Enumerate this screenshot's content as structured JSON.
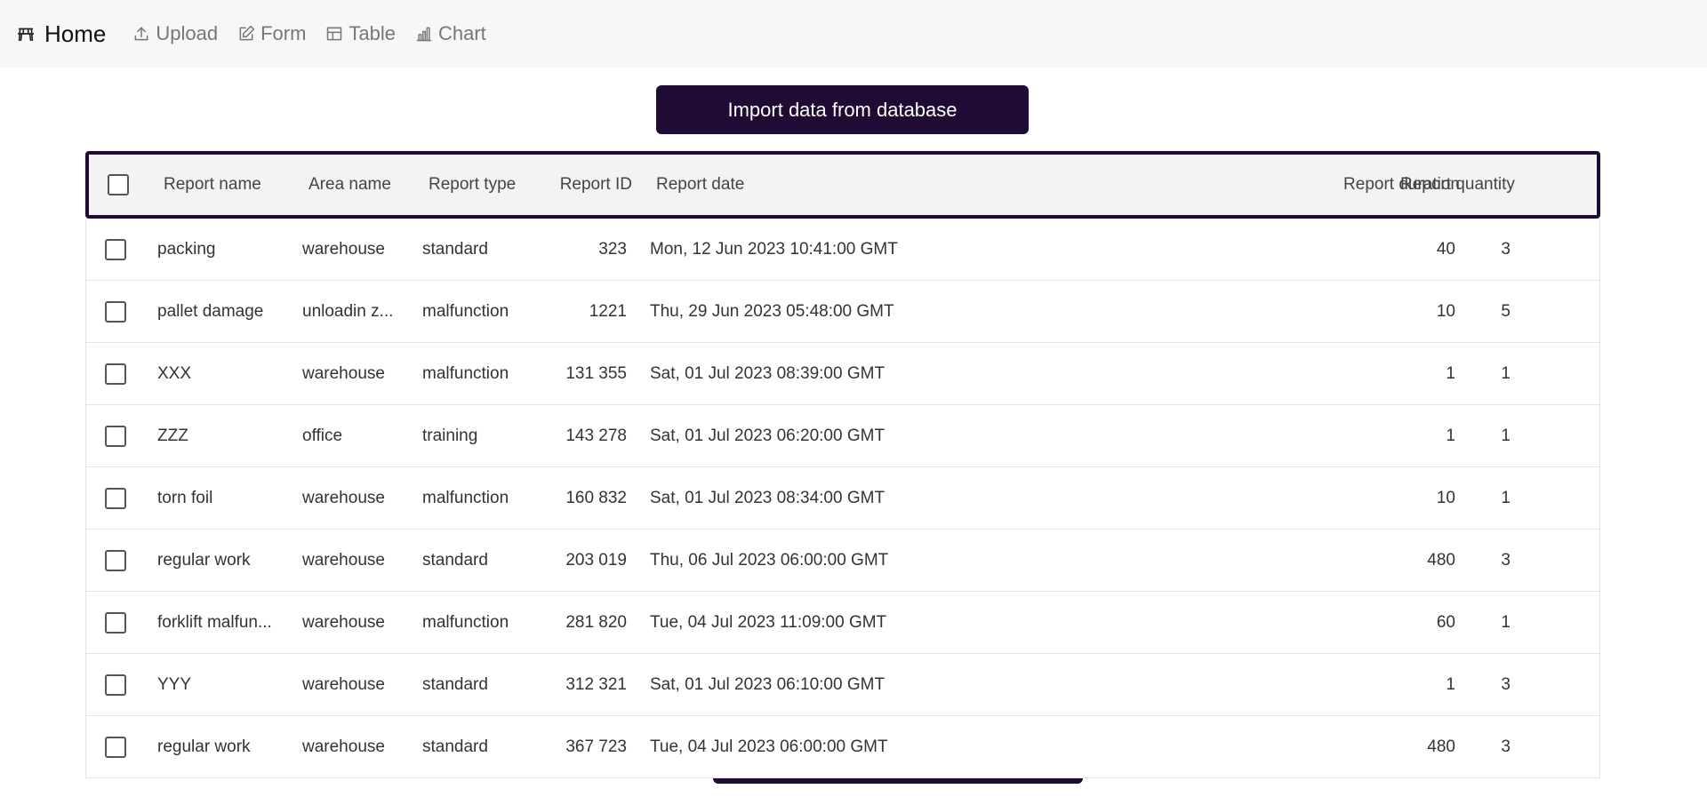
{
  "nav": {
    "home": "Home",
    "upload": "Upload",
    "form": "Form",
    "table": "Table",
    "chart": "Chart"
  },
  "import_button": "Import data from database",
  "table": {
    "headers": {
      "name": "Report name",
      "area": "Area name",
      "type": "Report type",
      "id": "Report ID",
      "date": "Report date",
      "duration": "Report duration",
      "quantity": "Report quantity"
    },
    "rows": [
      {
        "name": "packing",
        "area": "warehouse",
        "type": "standard",
        "id": "323",
        "date": "Mon, 12 Jun 2023 10:41:00 GMT",
        "duration": "40",
        "quantity": "3"
      },
      {
        "name": "pallet damage",
        "area": "unloadin z...",
        "type": "malfunction",
        "id": "1221",
        "date": "Thu, 29 Jun 2023 05:48:00 GMT",
        "duration": "10",
        "quantity": "5"
      },
      {
        "name": "XXX",
        "area": "warehouse",
        "type": "malfunction",
        "id": "131 355",
        "date": "Sat, 01 Jul 2023 08:39:00 GMT",
        "duration": "1",
        "quantity": "1"
      },
      {
        "name": "ZZZ",
        "area": "office",
        "type": "training",
        "id": "143 278",
        "date": "Sat, 01 Jul 2023 06:20:00 GMT",
        "duration": "1",
        "quantity": "1"
      },
      {
        "name": "torn foil",
        "area": "warehouse",
        "type": "malfunction",
        "id": "160 832",
        "date": "Sat, 01 Jul 2023 08:34:00 GMT",
        "duration": "10",
        "quantity": "1"
      },
      {
        "name": "regular work",
        "area": "warehouse",
        "type": "standard",
        "id": "203 019",
        "date": "Thu, 06 Jul 2023 06:00:00 GMT",
        "duration": "480",
        "quantity": "3"
      },
      {
        "name": "forklift malfun...",
        "area": "warehouse",
        "type": "malfunction",
        "id": "281 820",
        "date": "Tue, 04 Jul 2023 11:09:00 GMT",
        "duration": "60",
        "quantity": "1"
      },
      {
        "name": "YYY",
        "area": "warehouse",
        "type": "standard",
        "id": "312 321",
        "date": "Sat, 01 Jul 2023 06:10:00 GMT",
        "duration": "1",
        "quantity": "3"
      },
      {
        "name": "regular work",
        "area": "warehouse",
        "type": "standard",
        "id": "367 723",
        "date": "Tue, 04 Jul 2023 06:00:00 GMT",
        "duration": "480",
        "quantity": "3"
      }
    ]
  }
}
